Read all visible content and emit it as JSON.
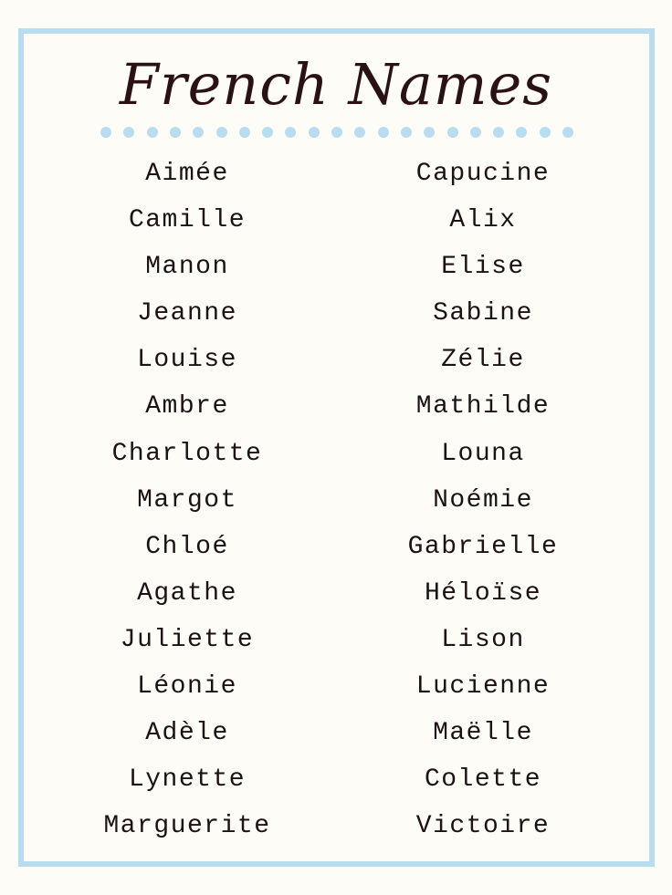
{
  "title": "French Names",
  "colors": {
    "background": "#fdfcf7",
    "border": "#b8dcf0",
    "dots": "#b8dcf0",
    "text": "#1c1213",
    "title": "#2a1214"
  },
  "divider": {
    "style": "dotted",
    "dot_count": 21
  },
  "names": {
    "left": [
      "Aimée",
      "Camille",
      "Manon",
      "Jeanne",
      "Louise",
      "Ambre",
      "Charlotte",
      "Margot",
      "Chloé",
      "Agathe",
      "Juliette",
      "Léonie",
      "Adèle",
      "Lynette",
      "Marguerite"
    ],
    "right": [
      "Capucine",
      "Alix",
      "Elise",
      "Sabine",
      "Zélie",
      "Mathilde",
      "Louna",
      "Noémie",
      "Gabrielle",
      "Héloïse",
      "Lison",
      "Lucienne",
      "Maëlle",
      "Colette",
      "Victoire"
    ]
  }
}
